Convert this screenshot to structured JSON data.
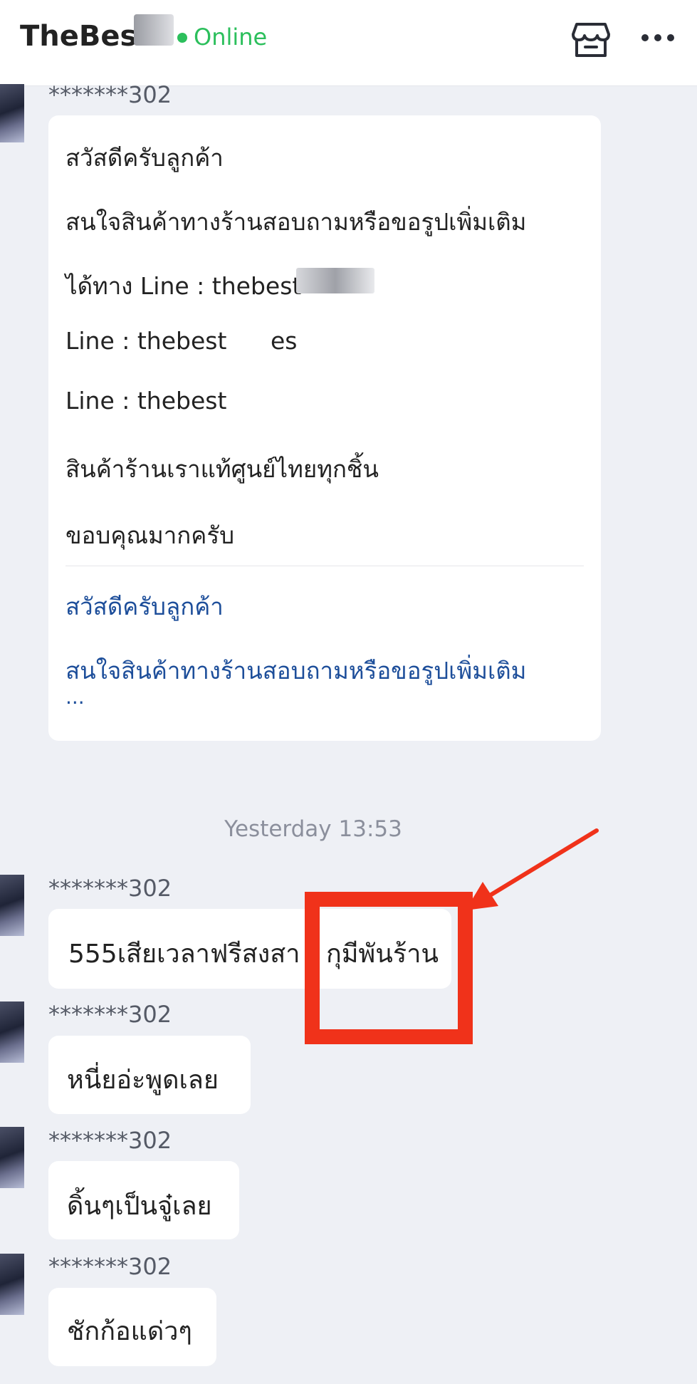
{
  "header": {
    "title": "TheBes",
    "status": "Online",
    "icons": [
      "store-icon",
      "more-icon"
    ]
  },
  "messages": {
    "sender": "*******302",
    "first": {
      "lines": [
        "สวัสดีครับลูกค้า",
        "สนใจสินค้าทางร้านสอบถามหรือขอรูปเพิ่มเติม",
        "ได้ทาง Line : thebest",
        "Line : thebest",
        "es",
        "Line : thebest",
        " สินค้าร้านเราแท้ศูนย์ไทยทุกชิ้น",
        "ขอบคุณมากครับ"
      ],
      "quoted": [
        "สวัสดีครับลูกค้า",
        "สนใจสินค้าทางร้านสอบถามหรือขอรูปเพิ่มเติม",
        "..."
      ]
    },
    "timestamp": "Yesterday 13:53",
    "m1": "555เสียเวลาฟรีสงสา",
    "m1b": "กุมีพันร้าน",
    "m2": "หนี่ยอ่ะพูดเลย",
    "m3": "ดิ้นๆเป็นจู๋เลย",
    "m4": "ชักก้อแด่วๆ"
  },
  "colors": {
    "online": "#2cbf5c",
    "link": "#1d4e9a",
    "annotation": "#f0321a"
  }
}
